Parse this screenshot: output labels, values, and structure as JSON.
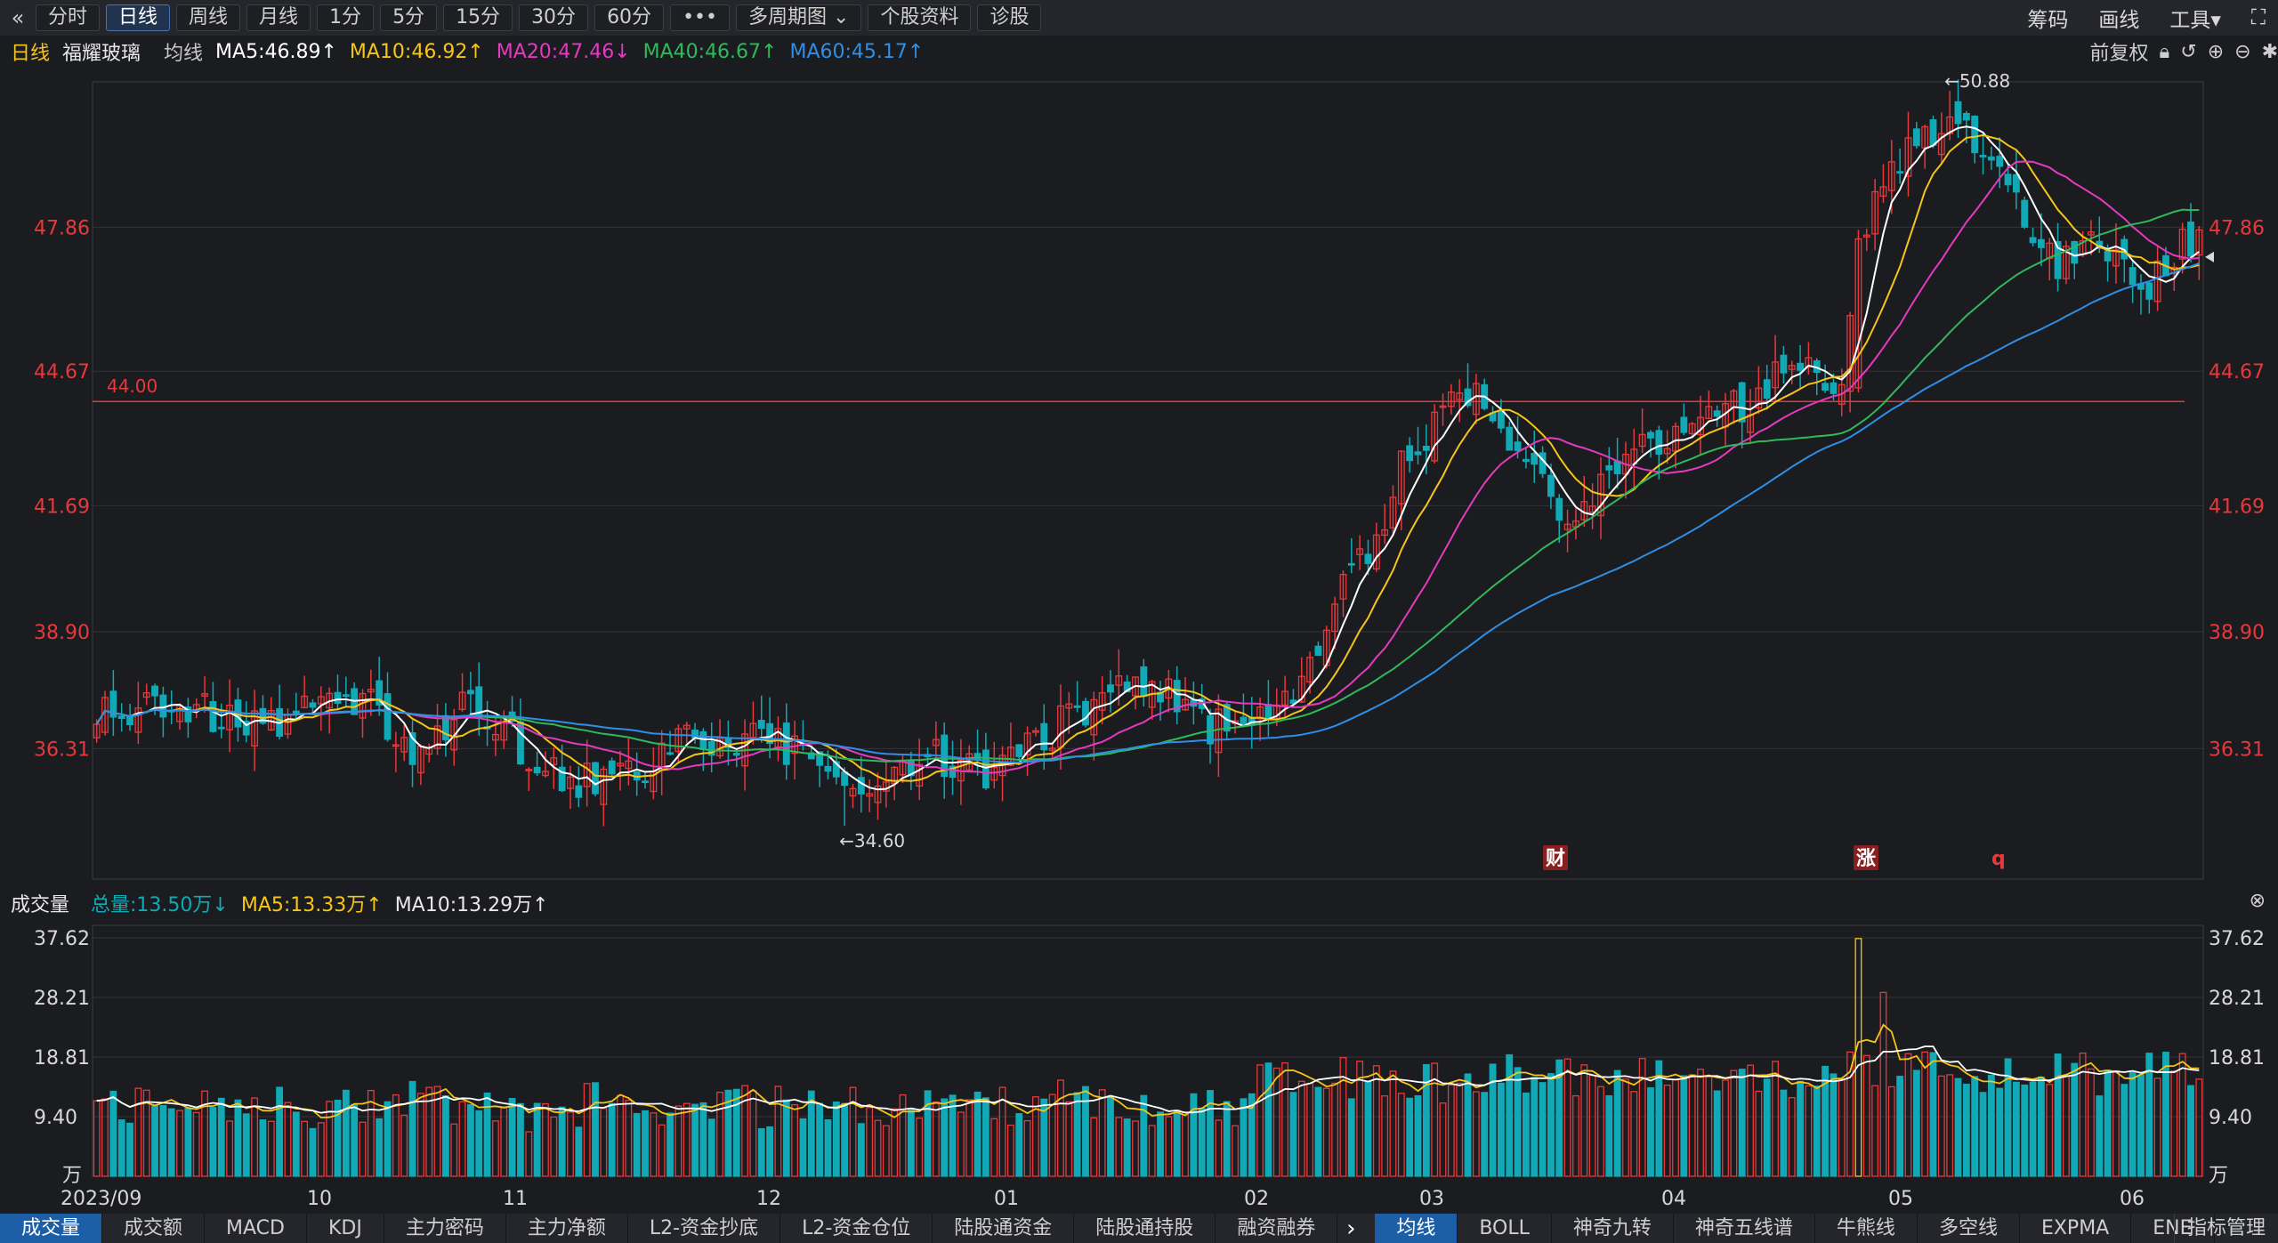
{
  "toolbar": {
    "back_icon": "«",
    "tabs": [
      "分时",
      "日线",
      "周线",
      "月线",
      "1分",
      "5分",
      "15分",
      "30分",
      "60分",
      "•••",
      "多周期图 ⌄",
      "个股资料",
      "诊股"
    ],
    "active_tab": "日线",
    "right": [
      "筹码",
      "画线",
      "工具▾"
    ],
    "fullscreen_icon": "⛶"
  },
  "info": {
    "period": "日线",
    "stock_name": "福耀玻璃",
    "indicator_name": "均线",
    "ma5": "MA5:46.89↑",
    "ma10": "MA10:46.92↑",
    "ma20": "MA20:47.46↓",
    "ma40": "MA40:46.67↑",
    "ma60": "MA60:45.17↑",
    "adjust": "前复权"
  },
  "colors": {
    "up": "#e6393c",
    "down": "#12a9b7",
    "ma5": "#ffffff",
    "ma10": "#f5c518",
    "ma20": "#e43ac0",
    "ma40": "#2fb95a",
    "ma60": "#2e8fe6",
    "volume_total": "#12a9b7"
  },
  "chart_data": [
    {
      "type": "candlestick",
      "title": "福耀玻璃 日线",
      "y_ticks": [
        "47.86",
        "44.67",
        "41.69",
        "38.90",
        "36.31"
      ],
      "ylim": [
        33.5,
        51.0
      ],
      "x_labels": [
        "2023/09",
        "10",
        "11",
        "12",
        "01",
        "02",
        "03",
        "04",
        "05",
        "06"
      ],
      "reference_line": {
        "value": 44.0,
        "label": "44.00"
      },
      "annotations": {
        "high": "←50.88",
        "low": "←34.60"
      },
      "markers": [
        "财",
        "涨",
        "q"
      ],
      "anchors": [
        [
          0,
          37.0
        ],
        [
          10,
          37.2
        ],
        [
          22,
          36.9
        ],
        [
          32,
          37.5
        ],
        [
          38,
          36.2
        ],
        [
          44,
          37.3
        ],
        [
          50,
          36.5
        ],
        [
          58,
          35.6
        ],
        [
          65,
          35.7
        ],
        [
          70,
          36.6
        ],
        [
          78,
          36.5
        ],
        [
          86,
          36.3
        ],
        [
          92,
          35.1
        ],
        [
          96,
          36.1
        ],
        [
          102,
          36.1
        ],
        [
          108,
          35.6
        ],
        [
          114,
          36.6
        ],
        [
          120,
          37.4
        ],
        [
          128,
          37.6
        ],
        [
          134,
          36.8
        ],
        [
          140,
          36.9
        ],
        [
          146,
          38.1
        ],
        [
          150,
          40.0
        ],
        [
          154,
          41.0
        ],
        [
          156,
          42.2
        ],
        [
          160,
          43.3
        ],
        [
          163,
          44.3
        ],
        [
          168,
          43.8
        ],
        [
          172,
          42.6
        ],
        [
          176,
          41.4
        ],
        [
          180,
          41.8
        ],
        [
          186,
          42.9
        ],
        [
          192,
          43.7
        ],
        [
          198,
          43.8
        ],
        [
          204,
          44.9
        ],
        [
          208,
          44.2
        ],
        [
          210,
          44.6
        ],
        [
          212,
          47.6
        ],
        [
          215,
          49.0
        ],
        [
          220,
          49.8
        ],
        [
          224,
          50.3
        ],
        [
          228,
          49.5
        ],
        [
          232,
          48.0
        ],
        [
          236,
          47.0
        ],
        [
          240,
          47.7
        ],
        [
          244,
          47.1
        ],
        [
          247,
          46.7
        ],
        [
          250,
          47.2
        ],
        [
          253,
          47.8
        ]
      ],
      "ma": [
        {
          "name": "MA5",
          "value": 46.89
        },
        {
          "name": "MA10",
          "value": 46.92
        },
        {
          "name": "MA20",
          "value": 47.46
        },
        {
          "name": "MA40",
          "value": 46.67
        },
        {
          "name": "MA60",
          "value": 45.17
        }
      ]
    },
    {
      "type": "bar",
      "title": "成交量",
      "unit": "万",
      "y_ticks": [
        "37.62",
        "28.21",
        "18.81",
        "9.40"
      ],
      "ylim": [
        0,
        37.62
      ],
      "total": "总量:13.50万↓",
      "ma5": "MA5:13.33万↑",
      "ma10": "MA10:13.29万↑"
    }
  ],
  "volume": {
    "label": "成交量",
    "total": "总量:13.50万↓",
    "ma5": "MA5:13.33万↑",
    "ma10": "MA10:13.29万↑",
    "unit": "万"
  },
  "bottom": {
    "tabs": [
      "成交量",
      "成交额",
      "MACD",
      "KDJ",
      "主力密码",
      "主力净额",
      "L2-资金抄底",
      "L2-资金仓位",
      "陆股通资金",
      "陆股通持股",
      "融资融券"
    ],
    "more_icon": "›",
    "tabs2": [
      "均线",
      "BOLL",
      "神奇九转",
      "神奇五线谱",
      "牛熊线",
      "多空线",
      "EXPMA",
      "ENE"
    ],
    "right": "指标管理"
  }
}
